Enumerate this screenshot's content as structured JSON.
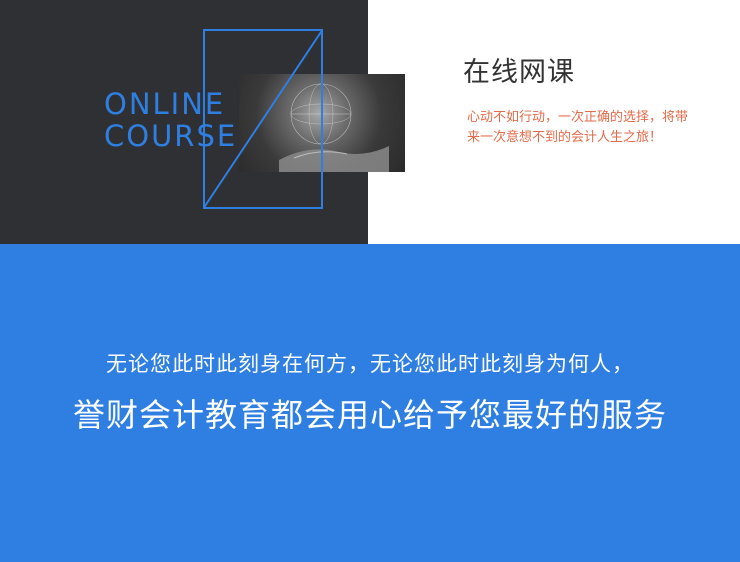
{
  "hero": {
    "online_line1": "ONLINE",
    "online_line2": "COURSE",
    "title": "在线网课",
    "description_line1": "心动不如行动，一次正确的选择，将带",
    "description_line2": "来一次意想不到的会计人生之旅！"
  },
  "banner": {
    "line1": "无论您此时此刻身在何方，无论您此时此刻身为何人，",
    "line2": "誉财会计教育都会用心给予您最好的服务"
  },
  "colors": {
    "dark_panel": "#2f3033",
    "accent_blue": "#2f7fe3",
    "description_text": "#e36b4a",
    "white": "#ffffff"
  }
}
